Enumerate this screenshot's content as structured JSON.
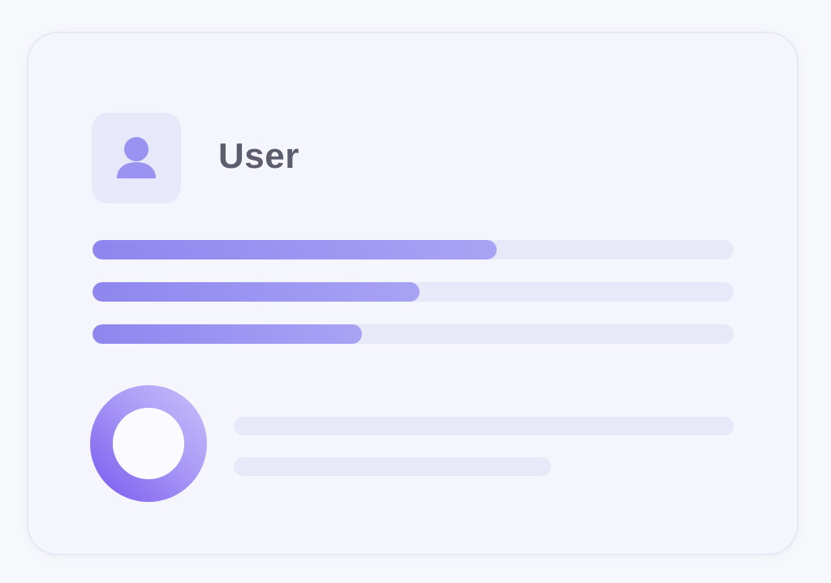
{
  "card": {
    "title": "User",
    "avatar_icon": "user-icon"
  },
  "progress_bars": [
    {
      "fill_percent": 63
    },
    {
      "fill_percent": 51
    },
    {
      "fill_percent": 42
    }
  ],
  "donut": {
    "icon": "donut-ring",
    "colors": [
      "#8b6ff3",
      "#b6a9f8"
    ]
  },
  "colors": {
    "accent": "#9a93f2",
    "track": "#e7e8f8",
    "title_text": "#5b5d6e",
    "card_background": "#f5f6fd"
  }
}
